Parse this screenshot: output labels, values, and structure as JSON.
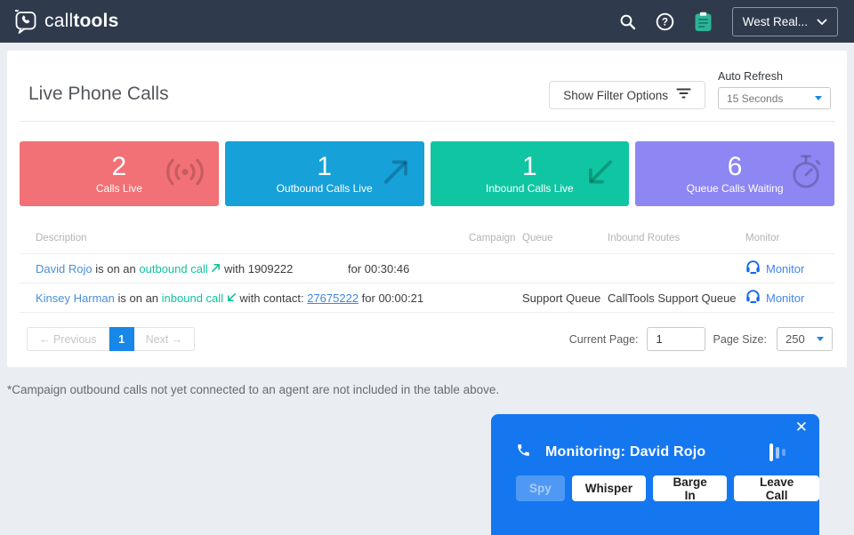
{
  "navbar": {
    "logo_call": "call",
    "logo_tools": "tools",
    "account_label": "West Real...",
    "bg": "#2f3b4d"
  },
  "page": {
    "title": "Live Phone Calls",
    "filter_button_label": "Show Filter Options",
    "auto_refresh_label": "Auto Refresh",
    "auto_refresh_value": "15 Seconds"
  },
  "stats": [
    {
      "value": "2",
      "label": "Calls Live",
      "color": "#f17176",
      "icon": "live-signal-icon"
    },
    {
      "value": "1",
      "label": "Outbound Calls Live",
      "color": "#16a1d9",
      "icon": "arrow-up-right-icon"
    },
    {
      "value": "1",
      "label": "Inbound Calls Live",
      "color": "#10c6a2",
      "icon": "arrow-down-left-icon"
    },
    {
      "value": "6",
      "label": "Queue Calls Waiting",
      "color": "#8e86f2",
      "icon": "stopwatch-icon"
    }
  ],
  "table": {
    "headers": [
      "Description",
      "Campaign",
      "Queue",
      "Inbound Routes",
      "Monitor"
    ],
    "rows": [
      {
        "agent": "David Rojo",
        "connector": "is on an",
        "call_type": "outbound call",
        "direction": "outbound",
        "with_text": "with 1909222",
        "contact_link": "",
        "duration": "for 00:30:46",
        "campaign": "",
        "queue": "",
        "inbound_routes": "",
        "monitor_label": "Monitor"
      },
      {
        "agent": "Kinsey Harman",
        "connector": "is on an",
        "call_type": "inbound call",
        "direction": "inbound",
        "with_text": "with contact:",
        "contact_link": "27675222",
        "duration": "for 00:00:21",
        "campaign": "",
        "queue": "Support Queue",
        "inbound_routes": "CallTools Support Queue",
        "monitor_label": "Monitor"
      }
    ]
  },
  "pagination": {
    "previous_label": "← Previous",
    "current_page": "1",
    "next_label": "Next →",
    "current_page_label": "Current Page:",
    "current_page_value": "1",
    "page_size_label": "Page Size:",
    "page_size_value": "250"
  },
  "footnote": "*Campaign outbound calls not yet connected to an agent are not included in the table above.",
  "monitor_popup": {
    "title": "Monitoring: David Rojo",
    "close_glyph": "✕",
    "buttons": [
      "Spy",
      "Whisper",
      "Barge In",
      "Leave Call"
    ],
    "bg": "#1577f0"
  },
  "colors": {
    "page_background": "#eaeef2",
    "link_blue": "#4a8ed8",
    "monitor_blue": "#3f86f0",
    "green_text": "#14c1a0",
    "pager_active": "#1787e8",
    "clipboard_teal": "#2eb398"
  }
}
